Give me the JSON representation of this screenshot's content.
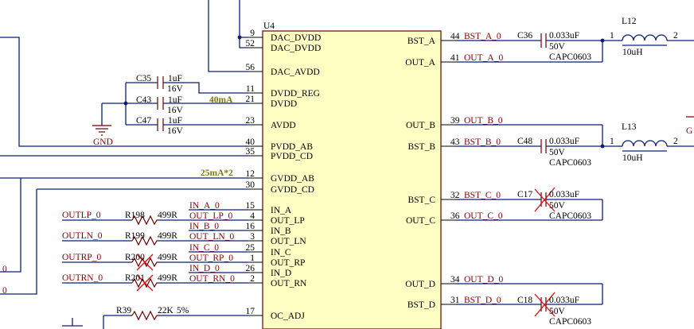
{
  "chip": {
    "ref": "U4",
    "left_pins": [
      {
        "num": "9",
        "name": "DAC_DVDD"
      },
      {
        "num": "52",
        "name": "DAC_DVDD"
      },
      {
        "num": "56",
        "name": "DAC_AVDD"
      },
      {
        "num": "11",
        "name": "DVDD_REG"
      },
      {
        "num": "21",
        "name": "DVDD"
      },
      {
        "num": "23",
        "name": "AVDD"
      },
      {
        "num": "40",
        "name": "PVDD_AB"
      },
      {
        "num": "35",
        "name": "PVDD_CD"
      },
      {
        "num": "12",
        "name": "GVDD_AB"
      },
      {
        "num": "30",
        "name": "GVDD_CD"
      },
      {
        "num": "15",
        "name": "IN_A"
      },
      {
        "num": "4",
        "name": "OUT_LP"
      },
      {
        "num": "16",
        "name": "IN_B"
      },
      {
        "num": "3",
        "name": "OUT_LN"
      },
      {
        "num": "25",
        "name": "IN_C"
      },
      {
        "num": "1",
        "name": "OUT_RP"
      },
      {
        "num": "26",
        "name": "IN_D"
      },
      {
        "num": "2",
        "name": "OUT_RN"
      },
      {
        "num": "17",
        "name": "OC_ADJ"
      }
    ],
    "right_pins": [
      {
        "num": "44",
        "name": "BST_A",
        "net": "BST_A_0"
      },
      {
        "num": "41",
        "name": "OUT_A",
        "net": "OUT_A_0"
      },
      {
        "num": "39",
        "name": "OUT_B",
        "net": "OUT_B_0"
      },
      {
        "num": "43",
        "name": "BST_B",
        "net": "BST_B_0"
      },
      {
        "num": "32",
        "name": "BST_C",
        "net": "BST_C_0"
      },
      {
        "num": "36",
        "name": "OUT_C",
        "net": "OUT_C_0"
      },
      {
        "num": "34",
        "name": "OUT_D",
        "net": "OUT_D_0"
      },
      {
        "num": "31",
        "name": "BST_D",
        "net": "BST_D_0"
      }
    ]
  },
  "left_nets": {
    "in_a": "IN_A_0",
    "out_lp": "OUT_LP_0",
    "in_b": "IN_B_0",
    "out_ln": "OUT_LN_0",
    "in_c": "IN_C_0",
    "out_rp": "OUT_RP_0",
    "in_d": "IN_D_0",
    "out_rn": "OUT_RN_0"
  },
  "inputs": [
    {
      "net": "OUTLP_0",
      "ref": "R198",
      "value": "499R",
      "dnp": false
    },
    {
      "net": "OUTLN_0",
      "ref": "R199",
      "value": "499R",
      "dnp": false
    },
    {
      "net": "OUTRP_0",
      "ref": "R200",
      "value": "499R",
      "dnp": true
    },
    {
      "net": "OUTRN_0",
      "ref": "R201",
      "value": "499R",
      "dnp": true
    }
  ],
  "decoupling": [
    {
      "ref": "C35",
      "value": "1uF",
      "voltage": "16V"
    },
    {
      "ref": "C43",
      "value": "1uF",
      "voltage": "16V"
    },
    {
      "ref": "C47",
      "value": "1uF",
      "voltage": "16V"
    }
  ],
  "gnd_label": "GND",
  "notes": {
    "dvdd_current": "40mA",
    "gvdd_current": "25mA*2"
  },
  "boot_caps": [
    {
      "ref": "C36",
      "value": "0.033uF",
      "voltage": "50V",
      "package": "CAPC0603",
      "dnp": false
    },
    {
      "ref": "C48",
      "value": "0.033uF",
      "voltage": "50V",
      "package": "CAPC0603",
      "dnp": false
    },
    {
      "ref": "C17",
      "value": "0.033uF",
      "voltage": "50V",
      "package": "CAPC0603",
      "dnp": true
    },
    {
      "ref": "C18",
      "value": "0.033uF",
      "voltage": "50V",
      "package": "CAPC0603",
      "dnp": true
    }
  ],
  "inductors": [
    {
      "ref": "L12",
      "value": "10uH",
      "pin1": "1",
      "pin2": "2"
    },
    {
      "ref": "L13",
      "value": "10uH",
      "pin1": "1",
      "pin2": "2"
    }
  ],
  "oc_resistor": {
    "ref": "R39",
    "value": "22K",
    "tolerance": "5%"
  },
  "edge_labels": {
    "left_a": "0",
    "left_b": "0",
    "right_g": "G"
  }
}
